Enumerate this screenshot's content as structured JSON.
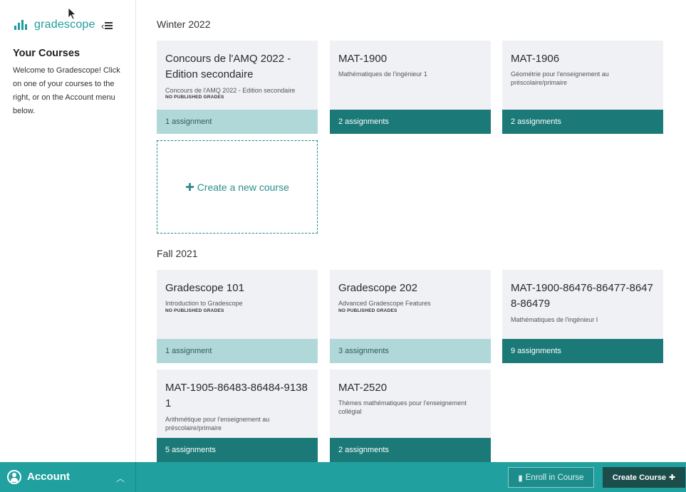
{
  "sidebar": {
    "logo_text": "gradescope",
    "heading": "Your Courses",
    "welcome": "Welcome to Gradescope! Click on one of your courses to the right, or on the Account menu below."
  },
  "terms": [
    {
      "name": "Winter 2022",
      "courses": [
        {
          "title": "Concours de l'AMQ 2022 - Edition secondaire",
          "subtitle": "Concours de l'AMQ 2022 - Edition secondaire",
          "badge": "NO PUBLISHED GRADES",
          "assignments": "1 assignment"
        },
        {
          "title": "MAT-1900",
          "subtitle": "Mathématiques de l'ingénieur 1",
          "badge": "",
          "assignments": "2 assignments"
        },
        {
          "title": "MAT-1906",
          "subtitle": "Géométrie pour l'enseignement au préscolaire/primaire",
          "badge": "",
          "assignments": "2 assignments"
        }
      ]
    },
    {
      "name": "Fall 2021",
      "courses": [
        {
          "title": "Gradescope 101",
          "subtitle": "Introduction to Gradescope",
          "badge": "NO PUBLISHED GRADES",
          "assignments": "1 assignment"
        },
        {
          "title": "Gradescope 202",
          "subtitle": "Advanced Gradescope Features",
          "badge": "NO PUBLISHED GRADES",
          "assignments": "3 assignments"
        },
        {
          "title": "MAT-1900-86476-86477-86478-86479",
          "subtitle": "Mathématiques de l'ingénieur I",
          "badge": "",
          "assignments": "9 assignments"
        },
        {
          "title": "MAT-1905-86483-86484-91381",
          "subtitle": "Arithmétique pour l'enseignement au préscolaire/primaire",
          "badge": "",
          "assignments": "5 assignments"
        },
        {
          "title": "MAT-2520",
          "subtitle": "Thèmes mathématiques pour l'enseignement collégial",
          "badge": "",
          "assignments": "2 assignments"
        }
      ]
    }
  ],
  "create_course_card": "Create a new course",
  "bottombar": {
    "account_label": "Account",
    "enroll_label": "Enroll in Course",
    "create_label": "Create Course"
  },
  "colors": {
    "brand_teal": "#21a0a0",
    "footer_dark": "#1b7a78",
    "footer_light": "#b0d8d9",
    "card_bg": "#f0f1f4"
  }
}
